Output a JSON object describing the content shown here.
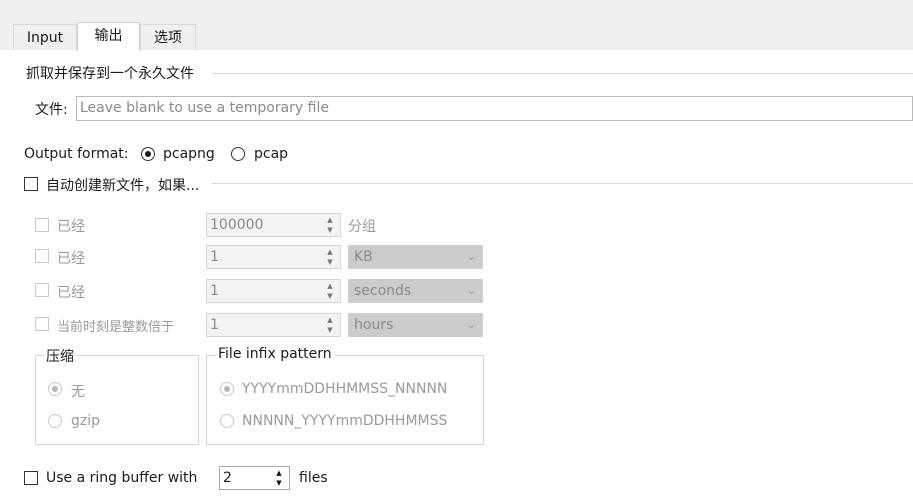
{
  "tabs": [
    {
      "label": "Input"
    },
    {
      "label": "输出"
    },
    {
      "label": "选项"
    }
  ],
  "capture_file": {
    "group_title": "抓取并保存到一个永久文件",
    "file_label": "文件:",
    "file_placeholder": "Leave blank to use a temporary file"
  },
  "output_format": {
    "label": "Output format:",
    "options": [
      "pcapng",
      "pcap"
    ],
    "selected": "pcapng"
  },
  "autocreate": {
    "label": "自动创建新文件，如果...",
    "rows": [
      {
        "label": "已经",
        "value": "100000",
        "unit": "分组"
      },
      {
        "label": "已经",
        "value": "1",
        "unit": "KB"
      },
      {
        "label": "已经",
        "value": "1",
        "unit": "seconds"
      },
      {
        "label": "当前时刻是整数倍于",
        "value": "1",
        "unit": "hours"
      }
    ]
  },
  "compression": {
    "title": "压缩",
    "options": [
      "无",
      "gzip"
    ],
    "selected": "无"
  },
  "infix": {
    "title": "File infix pattern",
    "options": [
      "YYYYmmDDHHMMSS_NNNNN",
      "NNNNN_YYYYmmDDHHMMSS"
    ],
    "selected": "YYYYmmDDHHMMSS_NNNNN"
  },
  "ring_buffer": {
    "label": "Use a ring buffer with",
    "value": "2",
    "suffix": "files"
  }
}
